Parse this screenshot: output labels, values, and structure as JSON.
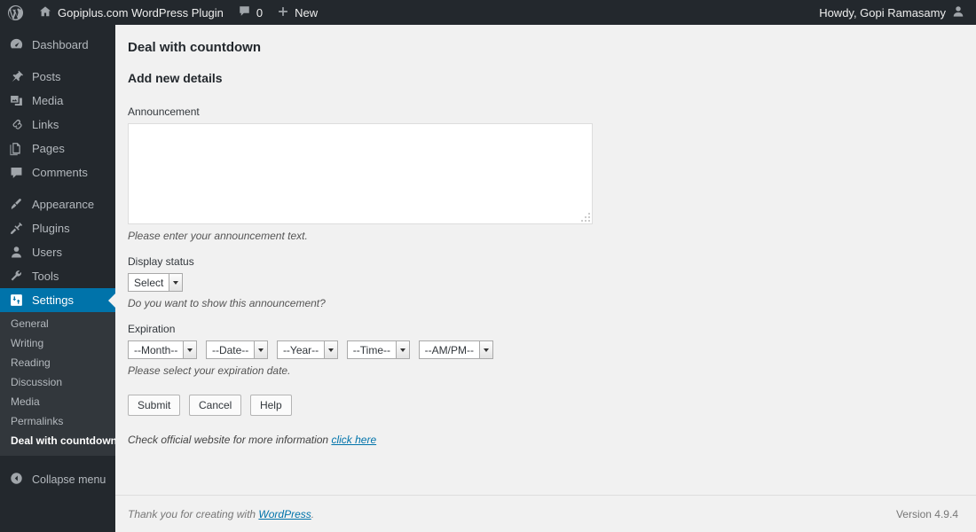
{
  "adminbar": {
    "logo_icon": "wordpress-logo-icon",
    "site_icon": "home-icon",
    "site_name": "Gopiplus.com WordPress Plugin",
    "comments_icon": "comment-bubble-icon",
    "comments_count": "0",
    "new_icon": "plus-icon",
    "new_label": "New",
    "howdy": "Howdy, Gopi Ramasamy",
    "avatar_icon": "user-avatar-icon"
  },
  "sidebar": {
    "items": [
      {
        "label": "Dashboard",
        "icon": "dashboard-icon"
      },
      {
        "label": "Posts",
        "icon": "pin-icon"
      },
      {
        "label": "Media",
        "icon": "media-icon"
      },
      {
        "label": "Links",
        "icon": "link-icon"
      },
      {
        "label": "Pages",
        "icon": "pages-icon"
      },
      {
        "label": "Comments",
        "icon": "comment-bubble-icon"
      },
      {
        "label": "Appearance",
        "icon": "paintbrush-icon"
      },
      {
        "label": "Plugins",
        "icon": "plug-icon"
      },
      {
        "label": "Users",
        "icon": "user-icon"
      },
      {
        "label": "Tools",
        "icon": "wrench-icon"
      },
      {
        "label": "Settings",
        "icon": "settings-sliders-icon"
      }
    ],
    "submenu": [
      {
        "label": "General"
      },
      {
        "label": "Writing"
      },
      {
        "label": "Reading"
      },
      {
        "label": "Discussion"
      },
      {
        "label": "Media"
      },
      {
        "label": "Permalinks"
      },
      {
        "label": "Deal with countdown"
      }
    ],
    "collapse": {
      "label": "Collapse menu",
      "icon": "collapse-arrow-icon"
    },
    "accent_color": "#0073aa"
  },
  "main": {
    "page_title": "Deal with countdown",
    "section_title": "Add new details",
    "announcement": {
      "label": "Announcement",
      "value": "",
      "hint": "Please enter your announcement text."
    },
    "display_status": {
      "label": "Display status",
      "selected": "Select",
      "hint": "Do you want to show this announcement?"
    },
    "expiration": {
      "label": "Expiration",
      "selects": [
        {
          "name": "month",
          "selected": "--Month--"
        },
        {
          "name": "date",
          "selected": "--Date--"
        },
        {
          "name": "year",
          "selected": "--Year--"
        },
        {
          "name": "time",
          "selected": "--Time--"
        },
        {
          "name": "ampm",
          "selected": "--AM/PM--"
        }
      ],
      "hint": "Please select your expiration date."
    },
    "buttons": {
      "submit": "Submit",
      "cancel": "Cancel",
      "help": "Help"
    },
    "official": {
      "text": "Check official website for more information ",
      "link": "click here"
    }
  },
  "footer": {
    "thanks_prefix": "Thank you for creating with ",
    "thanks_link": "WordPress",
    "thanks_suffix": ".",
    "version": "Version 4.9.4"
  }
}
